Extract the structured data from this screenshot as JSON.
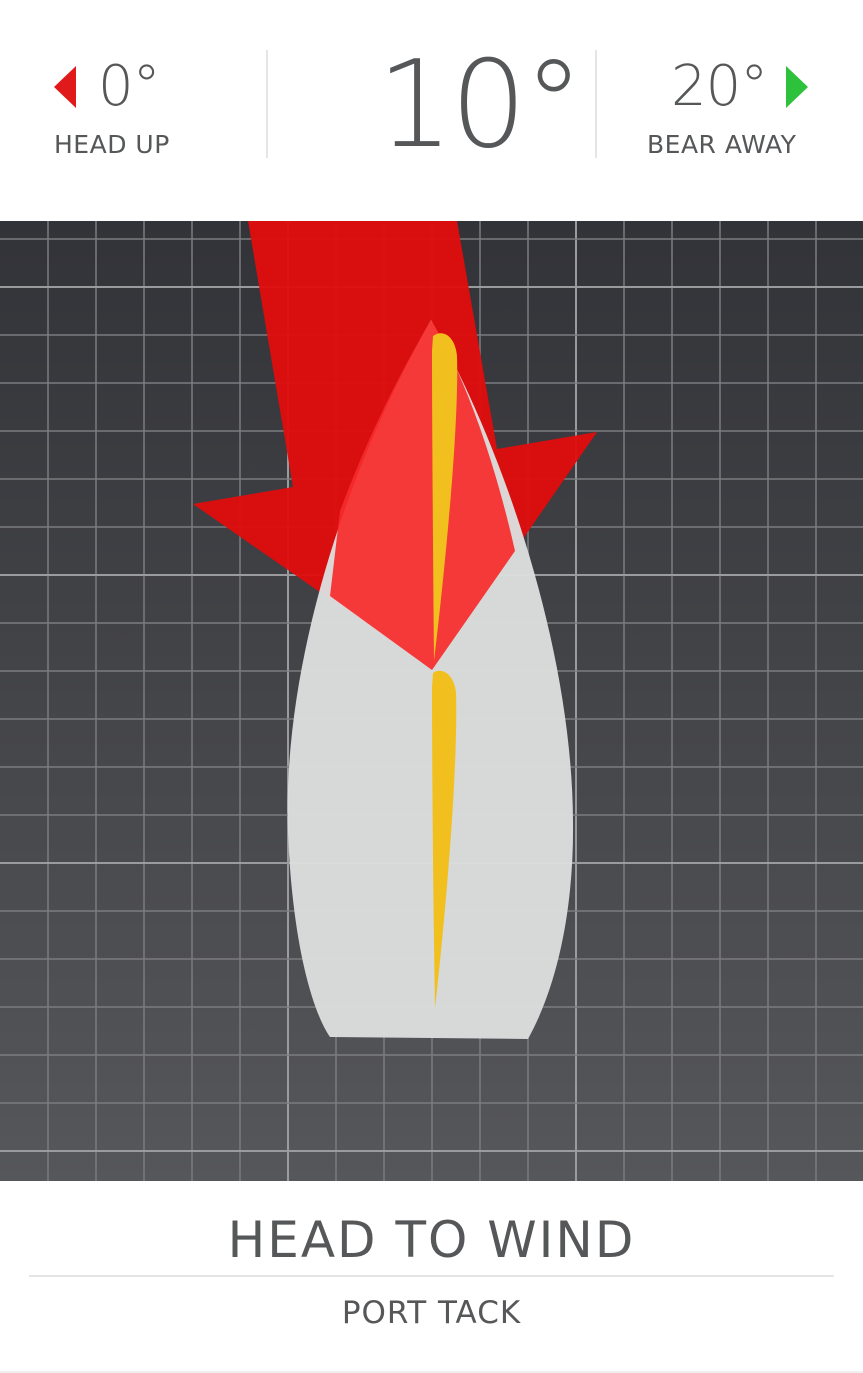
{
  "header": {
    "head_up": {
      "degrees": "0°",
      "label": "HEAD UP",
      "arrow_color": "#e0191a"
    },
    "current": {
      "degrees": "10°"
    },
    "bear_away": {
      "degrees": "20°",
      "label": "BEAR AWAY",
      "arrow_color": "#2ec13c"
    }
  },
  "status": {
    "point_of_sail": "HEAD TO WIND",
    "tack": "PORT TACK"
  },
  "colors": {
    "wind_arrow": "#e00d0d",
    "hull": "#dcdddd",
    "sail": "#f2c01e",
    "grid_bg_top": "#323338",
    "grid_bg_bottom": "#56575a"
  },
  "icons": {
    "head_up": "triangle-left-icon",
    "bear_away": "triangle-right-icon"
  }
}
